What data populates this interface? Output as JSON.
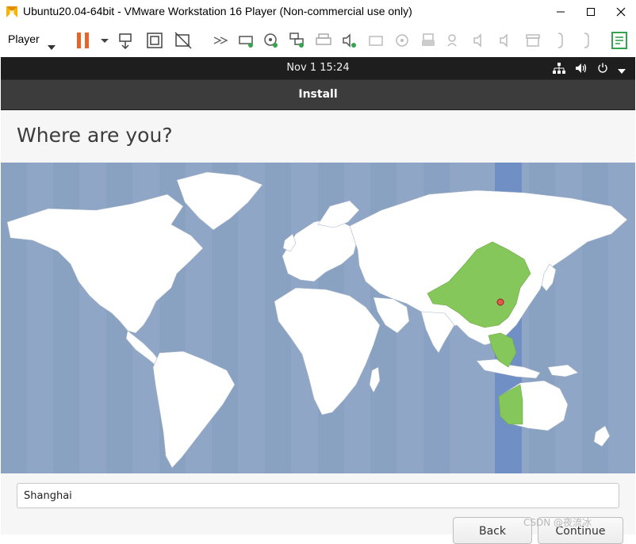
{
  "window": {
    "title": "Ubuntu20.04-64bit - VMware Workstation 16 Player (Non-commercial use only)",
    "controls": [
      "minimize-icon",
      "maximize-icon",
      "close-icon"
    ]
  },
  "toolbar": {
    "player_label": "Player",
    "icons": [
      "pause-icon",
      "send-ctrl-alt-del-icon",
      "fit-guest-icon",
      "unity-icon",
      "fast-forward-icon",
      "hard-disk-icon",
      "cd-dvd-icon",
      "network-adapter-icon",
      "printer-icon",
      "sound-card-icon",
      "camera-icon",
      "usb-device-icon",
      "storage-icon",
      "microphone-icon",
      "speaker-icon",
      "speaker-alt-icon",
      "archive-icon",
      "bracket-left-icon",
      "bracket-right-icon",
      "notes-icon"
    ]
  },
  "guest": {
    "clock": "Nov 1  15:24",
    "status_icons": [
      "network-icon",
      "volume-icon",
      "power-icon",
      "caret-down-icon"
    ]
  },
  "installer": {
    "title": "Install",
    "heading": "Where are you?",
    "location_value": "Shanghai",
    "back_label": "Back",
    "continue_label": "Continue"
  },
  "map": {
    "selected_timezone_highlight": "#85c75a",
    "selected_band_color": "#6f8fc5",
    "ocean_color": "#8fa6c6"
  },
  "watermark": "CSDN @夜流冰",
  "colors": {
    "pause_accent": "#e9642b",
    "notes_accent": "#35a44f",
    "topbar_bg": "#1e1e1e",
    "installbar_bg": "#3c3c3c"
  }
}
